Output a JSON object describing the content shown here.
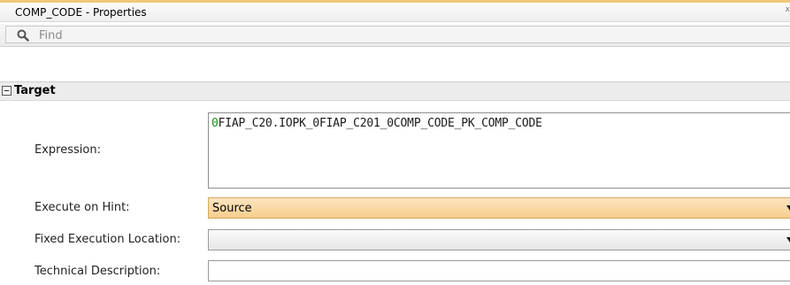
{
  "window": {
    "title": "COMP_CODE - Properties",
    "close_glyph": "x"
  },
  "find": {
    "placeholder": "Find",
    "icon": "search-icon"
  },
  "section": {
    "title": "Target",
    "icon": "collapse-icon"
  },
  "fields": {
    "expression": {
      "label": "Expression:",
      "value_first_char": "0",
      "value_rest": "FIAP_C20.IOPK_0FIAP_C201_0COMP_CODE_PK_COMP_CODE"
    },
    "execute_on_hint": {
      "label": "Execute on Hint:",
      "value": "Source"
    },
    "fixed_execution_location": {
      "label": "Fixed Execution Location:",
      "value": ""
    },
    "technical_description": {
      "label": "Technical Description:",
      "value": ""
    }
  },
  "colors": {
    "accent_border": "#f0c878",
    "selected_dropdown": "#f7cf8d"
  }
}
